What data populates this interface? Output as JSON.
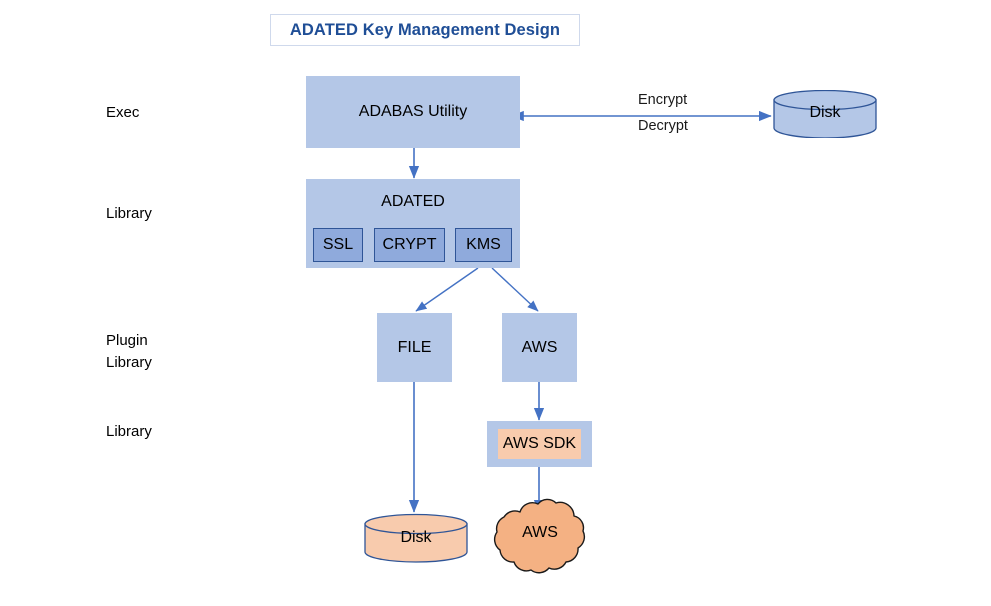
{
  "title": {
    "text": "ADATED Key Management Design"
  },
  "row_labels": [
    {
      "id": "exec",
      "text": "Exec"
    },
    {
      "id": "library-1",
      "text": "Library"
    },
    {
      "id": "plugin-library",
      "text": "Plugin\nLibrary"
    },
    {
      "id": "library-2",
      "text": "Library"
    }
  ],
  "nodes": {
    "adabas_utility": {
      "label": "ADABAS Utility"
    },
    "adated": {
      "label": "ADATED"
    },
    "ssl": {
      "label": "SSL"
    },
    "crypt": {
      "label": "CRYPT"
    },
    "kms": {
      "label": "KMS"
    },
    "file": {
      "label": "FILE"
    },
    "aws": {
      "label": "AWS"
    },
    "aws_sdk": {
      "label": "AWS SDK"
    },
    "disk_top": {
      "label": "Disk"
    },
    "disk_bottom": {
      "label": "Disk"
    },
    "aws_cloud": {
      "label": "AWS"
    }
  },
  "edge_labels": {
    "encrypt": "Encrypt",
    "decrypt": "Decrypt"
  },
  "colors": {
    "title_text": "#1f4e96",
    "box_blue": "#b4c7e7",
    "box_sub_blue": "#8faadc",
    "box_sub_border": "#2f5597",
    "box_peach": "#f8cbad",
    "connector": "#4472c4",
    "cylinder_blue_fill": "#b4c7e7",
    "cylinder_blue_stroke": "#2f5597",
    "cylinder_peach_fill": "#f8cbad",
    "cylinder_peach_stroke": "#2f5597",
    "cloud_fill": "#f4b183",
    "cloud_stroke": "#1a1a1a"
  }
}
